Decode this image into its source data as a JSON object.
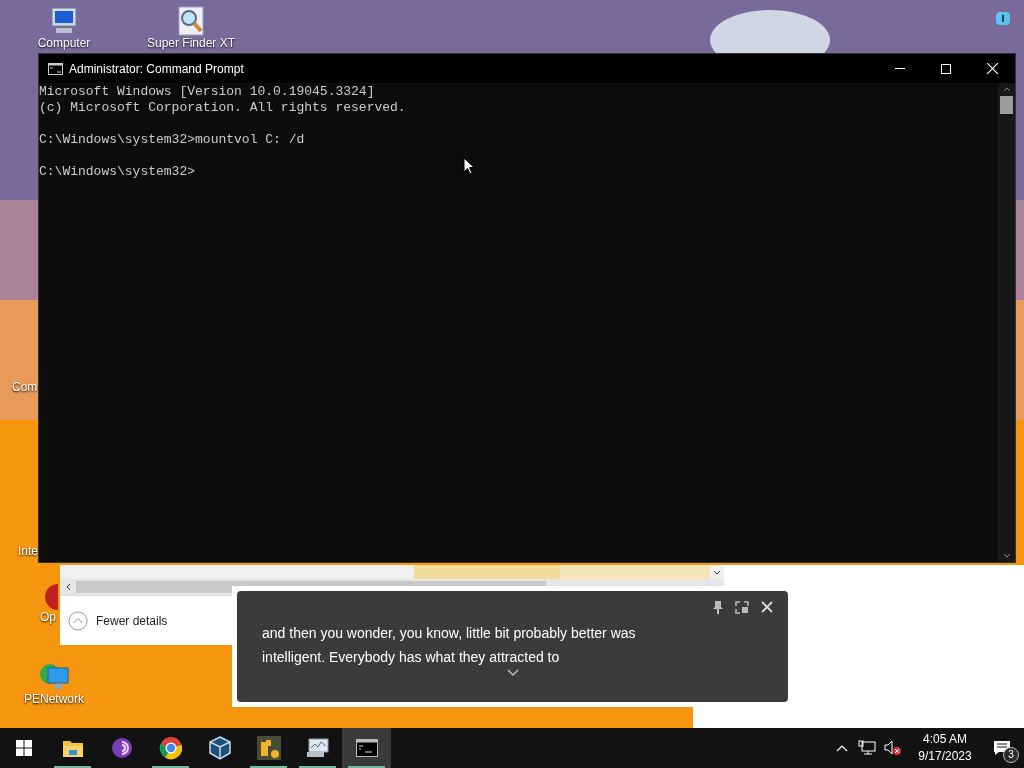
{
  "desktop_icons": [
    {
      "label": "Computer",
      "kind": "computer"
    },
    {
      "label": "Super Finder XT",
      "kind": "finder"
    },
    {
      "label": "Com",
      "kind": "none"
    },
    {
      "label": "Inte",
      "kind": "none"
    },
    {
      "label": "Op",
      "kind": "ball"
    },
    {
      "label": "PENetwork",
      "kind": "network"
    }
  ],
  "cmd_window": {
    "title": "Administrator: Command Prompt",
    "blocks": [
      [
        "Microsoft Windows [Version 10.0.19045.3324]",
        "(c) Microsoft Corporation. All rights reserved."
      ],
      [
        "C:\\Windows\\system32>mountvol C: /d"
      ],
      [
        "C:\\Windows\\system32>"
      ]
    ]
  },
  "background_window": {
    "toggle": "Fewer details"
  },
  "live_caption": {
    "lines": [
      "and then you wonder, you know, little bit probably better was",
      "intelligent. Everybody has what they attracted to"
    ]
  },
  "taskbar": {
    "apps": [
      {
        "kind": "folder",
        "running": true,
        "selected": false
      },
      {
        "kind": "onion",
        "running": false,
        "selected": false
      },
      {
        "kind": "browser",
        "running": true,
        "selected": false
      },
      {
        "kind": "cube",
        "running": false,
        "selected": false
      },
      {
        "kind": "tool",
        "running": true,
        "selected": false
      },
      {
        "kind": "monitor",
        "running": true,
        "selected": false
      },
      {
        "kind": "terminal",
        "running": true,
        "selected": true
      }
    ],
    "time": "4:05 AM",
    "date": "9/17/2023",
    "notification_count": "3"
  }
}
